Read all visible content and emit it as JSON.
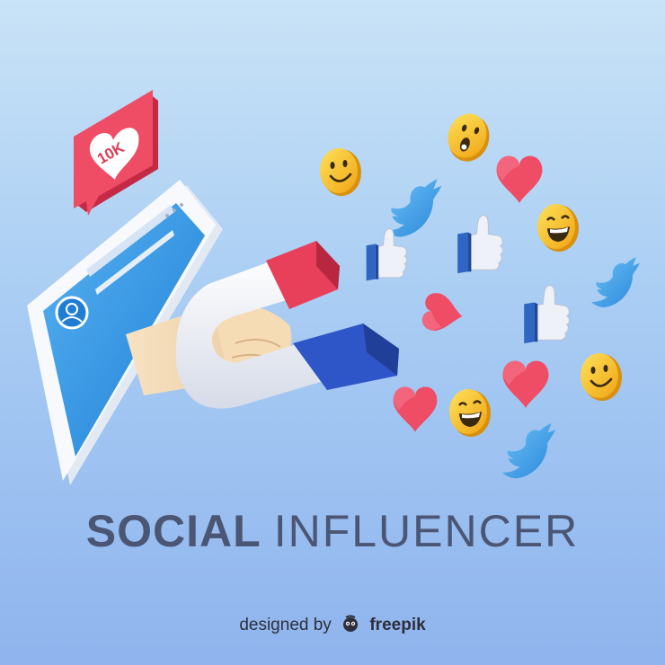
{
  "notification": {
    "label": "10K"
  },
  "headline": {
    "bold": "SOCIAL",
    "light": "INFLUENCER"
  },
  "credit": {
    "prefix": "designed by",
    "brand": "freepik"
  },
  "colors": {
    "background_top": "#c9e3f7",
    "background_bottom": "#8fb4ee",
    "heart": "#ef4c66",
    "emoji": "#f5c21b",
    "twitter": "#3aa0e8",
    "thumbs_cuff": "#2f66c4",
    "magnet_red": "#e83f5b",
    "magnet_blue": "#2f56c8",
    "headline": "#4b5675"
  },
  "icons": [
    "heart-icon",
    "emoji-icon",
    "twitter-bird-icon",
    "thumbs-up-icon",
    "magnet-icon",
    "notification-bubble-icon",
    "avatar-icon"
  ]
}
